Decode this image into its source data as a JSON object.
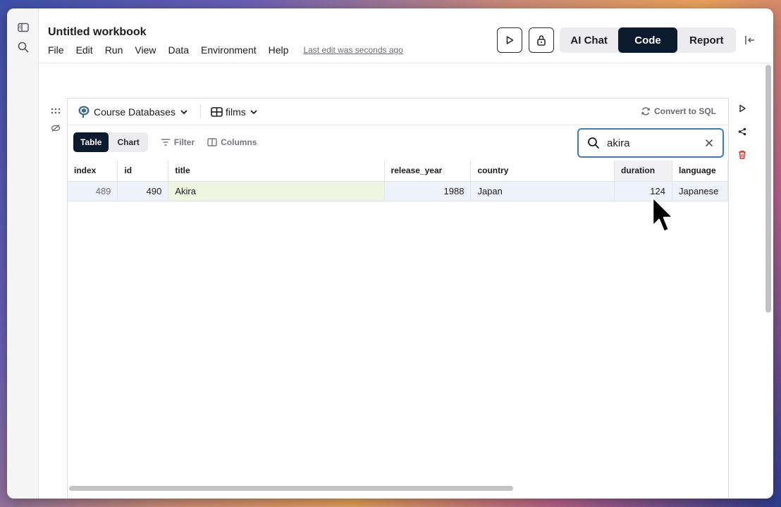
{
  "window": {
    "title": "Untitled workbook",
    "menu": [
      "File",
      "Edit",
      "Run",
      "View",
      "Data",
      "Environment",
      "Help"
    ],
    "last_edit": "Last edit was seconds ago"
  },
  "modes": {
    "ai_chat": "AI Chat",
    "code": "Code",
    "report": "Report",
    "active": "Code"
  },
  "cell": {
    "database": "Course Databases",
    "table": "films",
    "convert": "Convert to SQL",
    "view_tabs": {
      "table": "Table",
      "chart": "Chart",
      "active": "Table"
    },
    "filter": "Filter",
    "columns": "Columns",
    "search_value": "akira"
  },
  "grid": {
    "headers": [
      "index",
      "id",
      "title",
      "release_year",
      "country",
      "duration",
      "language"
    ],
    "rows": [
      {
        "index": "489",
        "id": "490",
        "title": "Akira",
        "release_year": "1988",
        "country": "Japan",
        "duration": "124",
        "language": "Japanese"
      }
    ]
  },
  "colors": {
    "accent_dark": "#0c1a2e",
    "search_border": "#3b79c9",
    "delete_red": "#c0392b"
  },
  "icons": [
    "sidebar-icon",
    "search-icon",
    "play-icon",
    "lock-icon",
    "collapse-panel-icon",
    "postgres-icon",
    "chevron-down-icon",
    "table-grid-icon",
    "refresh-icon",
    "filter-icon",
    "columns-icon",
    "close-icon",
    "drag-handle-icon",
    "hide-icon",
    "share-icon",
    "trash-icon",
    "mouse-cursor-icon"
  ]
}
